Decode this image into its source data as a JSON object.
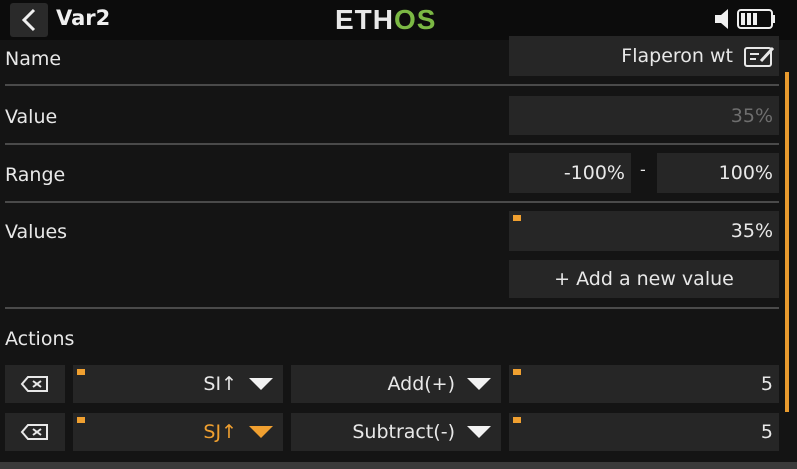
{
  "header": {
    "title": "Var2",
    "logo_prefix": "ETH",
    "logo_suffix": "OS"
  },
  "colors": {
    "accent": "#f0a030",
    "logo_green": "#7bb844",
    "field_bg": "#262626"
  },
  "form": {
    "name_label": "Name",
    "name_value": "Flaperon wt",
    "value_label": "Value",
    "value_value": "35%",
    "range_label": "Range",
    "range_min": "-100%",
    "range_separator": "-",
    "range_max": "100%",
    "values_label": "Values",
    "values_item": "35%",
    "add_value_button": "+ Add a new value"
  },
  "actions": {
    "label": "Actions",
    "rows": [
      {
        "switch": "SI↑",
        "operation": "Add(+)",
        "amount": "5",
        "highlighted": false
      },
      {
        "switch": "SJ↑",
        "operation": "Subtract(-)",
        "amount": "5",
        "highlighted": true
      }
    ]
  }
}
